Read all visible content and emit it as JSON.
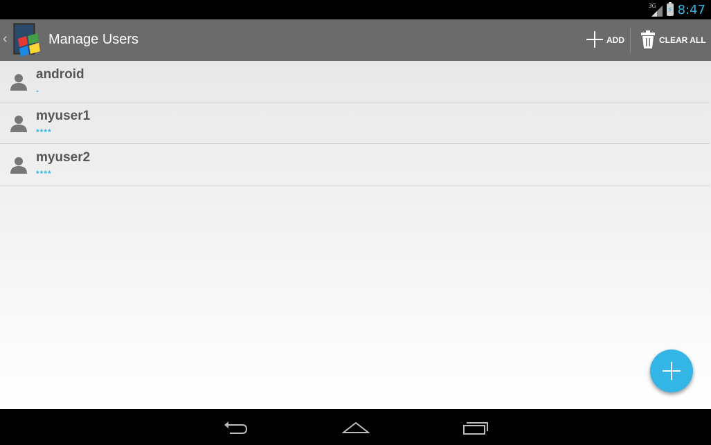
{
  "status_bar": {
    "network_label": "3G",
    "time": "8:47"
  },
  "action_bar": {
    "title": "Manage Users",
    "add_label": "ADD",
    "clear_all_label": "CLEAR ALL"
  },
  "users": [
    {
      "name": "android",
      "password_mask": "-"
    },
    {
      "name": "myuser1",
      "password_mask": "****"
    },
    {
      "name": "myuser2",
      "password_mask": "****"
    }
  ],
  "icons": {
    "app": "windows-logo-app-icon",
    "add": "plus-icon",
    "clear_all": "trash-icon",
    "user": "person-icon",
    "fab": "plus-icon",
    "nav": [
      "back-icon",
      "home-icon",
      "recent-apps-icon"
    ]
  },
  "colors": {
    "accent": "#33b5e5",
    "action_bar": "#6b6b6b",
    "system_bars": "#000000"
  }
}
